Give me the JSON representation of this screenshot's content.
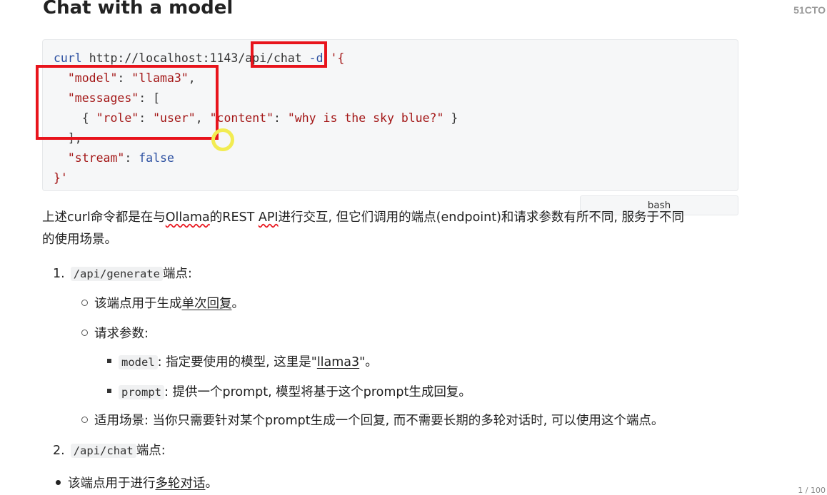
{
  "watermark": "51CTO",
  "heading": "Chat with a model",
  "code": {
    "language": "bash",
    "line1": {
      "cmd": "curl",
      "url_pre": "http://localhost:1143",
      "url_path": "/api/chat",
      "flag": "-d",
      "quote_open": "'{"
    },
    "line2": {
      "key": "\"model\"",
      "sep": ": ",
      "value": "\"llama3\"",
      "end": ","
    },
    "line3": {
      "key": "\"messages\"",
      "sep": ": ",
      "value": "["
    },
    "line4": {
      "open": "{ ",
      "k1": "\"role\"",
      "sep1": ": ",
      "v1": "\"user\"",
      "comma": ", ",
      "k2": "\"content\"",
      "sep2": ": ",
      "v2": "\"why is the sky blue?\"",
      "close": " }"
    },
    "line5": {
      "text": "],"
    },
    "line6": {
      "key": "\"stream\"",
      "sep": ": ",
      "value": "false"
    },
    "line7": {
      "text": "}'"
    }
  },
  "paragraph": {
    "part1": "上述curl命令都是在与",
    "ollama": "Ollama",
    "part2": "的REST ",
    "api": "API",
    "part3": "进行交互, 但它们调用的端点(endpoint)和请求参数有所不同, 服务于不同",
    "part4": "的使用场景。"
  },
  "list": {
    "item1": {
      "num": "1.",
      "code": "/api/generate",
      "suffix": "端点:"
    },
    "item1_sub1": {
      "prefix": "该端点用于生成",
      "underlined": "单次回复",
      "suffix": "。"
    },
    "item1_sub2": {
      "text": "请求参数:"
    },
    "item1_sub2_a": {
      "code": "model",
      "text": ": 指定要使用的模型, 这里是\"",
      "underlined": "llama3",
      "suffix": "\"。"
    },
    "item1_sub2_b": {
      "code": "prompt",
      "text": ": 提供一个prompt, 模型将基于这个prompt生成回复。"
    },
    "item1_sub3": {
      "text": "适用场景: 当你只需要针对某个prompt生成一个回复, 而不需要长期的多轮对话时, 可以使用这个端点。"
    },
    "item2": {
      "num": "2.",
      "code": "/api/chat",
      "suffix": "端点:"
    },
    "item2_sub1": {
      "prefix": "该端点用于进行",
      "underlined": "多轮对话",
      "suffix": "。"
    }
  },
  "page_indicator": "1 / 100",
  "colors": {
    "highlight_box": "#e8141c",
    "cursor_ring": "#f2ec52",
    "code_bg": "#f6f7f8"
  }
}
